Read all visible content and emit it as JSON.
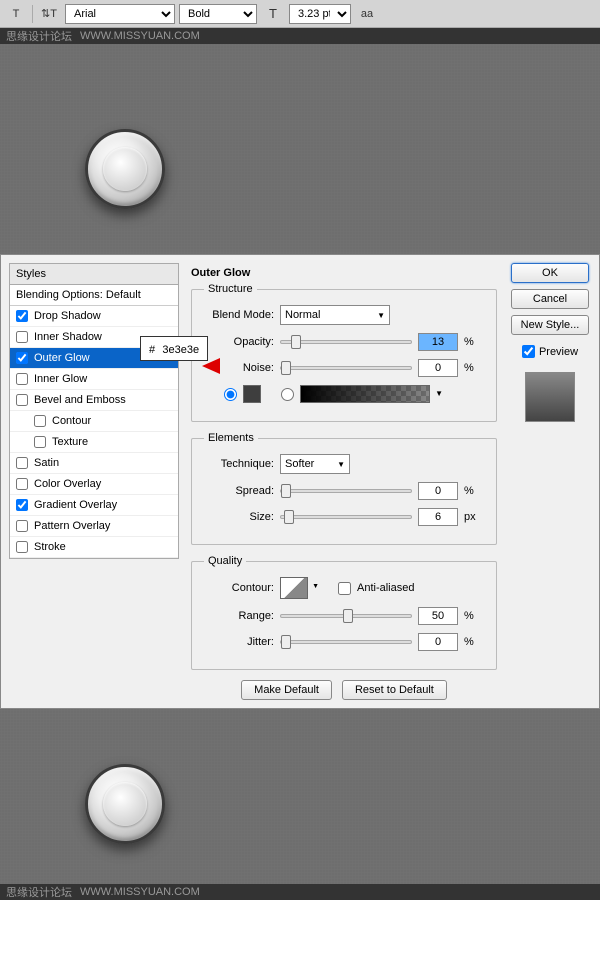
{
  "watermark": {
    "text": "思缘设计论坛",
    "url": "WWW.MISSYUAN.COM"
  },
  "toolbar": {
    "font": "Arial",
    "weight": "Bold",
    "size": "3.23 pt"
  },
  "callout": {
    "prefix": "#",
    "value": "3e3e3e"
  },
  "dialog": {
    "styles_header": "Styles",
    "blending_options": "Blending Options: Default",
    "items": [
      {
        "label": "Drop Shadow",
        "checked": true,
        "selected": false
      },
      {
        "label": "Inner Shadow",
        "checked": false,
        "selected": false
      },
      {
        "label": "Outer Glow",
        "checked": true,
        "selected": true
      },
      {
        "label": "Inner Glow",
        "checked": false,
        "selected": false
      },
      {
        "label": "Bevel and Emboss",
        "checked": false,
        "selected": false
      },
      {
        "label": "Contour",
        "checked": false,
        "selected": false,
        "indent": true
      },
      {
        "label": "Texture",
        "checked": false,
        "selected": false,
        "indent": true
      },
      {
        "label": "Satin",
        "checked": false,
        "selected": false
      },
      {
        "label": "Color Overlay",
        "checked": false,
        "selected": false
      },
      {
        "label": "Gradient Overlay",
        "checked": true,
        "selected": false
      },
      {
        "label": "Pattern Overlay",
        "checked": false,
        "selected": false
      },
      {
        "label": "Stroke",
        "checked": false,
        "selected": false
      }
    ],
    "title": "Outer Glow",
    "structure": {
      "legend": "Structure",
      "blend_mode_label": "Blend Mode:",
      "blend_mode": "Normal",
      "opacity_label": "Opacity:",
      "opacity": "13",
      "noise_label": "Noise:",
      "noise": "0",
      "glow_color": "#3e3e3e"
    },
    "elements": {
      "legend": "Elements",
      "technique_label": "Technique:",
      "technique": "Softer",
      "spread_label": "Spread:",
      "spread": "0",
      "size_label": "Size:",
      "size": "6",
      "size_unit": "px"
    },
    "quality": {
      "legend": "Quality",
      "contour_label": "Contour:",
      "antialiased_label": "Anti-aliased",
      "range_label": "Range:",
      "range": "50",
      "jitter_label": "Jitter:",
      "jitter": "0"
    },
    "buttons": {
      "make_default": "Make Default",
      "reset_default": "Reset to Default",
      "ok": "OK",
      "cancel": "Cancel",
      "new_style": "New Style...",
      "preview": "Preview"
    },
    "percent": "%"
  }
}
